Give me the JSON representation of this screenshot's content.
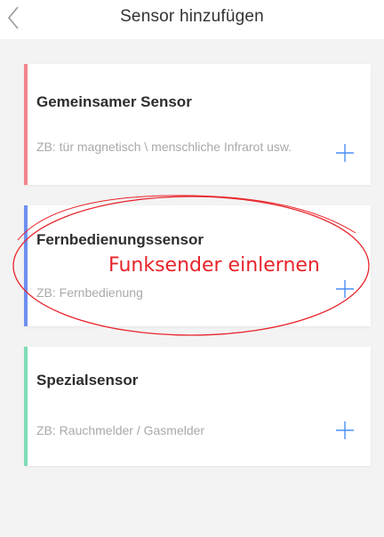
{
  "header": {
    "title": "Sensor hinzufügen",
    "back_icon": "chevron-left-icon"
  },
  "cards": [
    {
      "title": "Gemeinsamer Sensor",
      "subtitle": "ZB: tür magnetisch \\ menschliche Infrarot usw.",
      "accent_color": "#f4848f",
      "add_icon": "plus-icon"
    },
    {
      "title": "Fernbedienungssensor",
      "subtitle": "ZB: Fernbedienung",
      "accent_color": "#6e8ff0",
      "add_icon": "plus-icon"
    },
    {
      "title": "Spezialsensor",
      "subtitle": "ZB: Rauchmelder / Gasmelder",
      "accent_color": "#7edcb6",
      "add_icon": "plus-icon"
    }
  ],
  "annotation": {
    "text": "Funksender einlernen",
    "color": "#e8232a"
  },
  "colors": {
    "background": "#f3f3f3",
    "plus": "#4b8df8"
  }
}
